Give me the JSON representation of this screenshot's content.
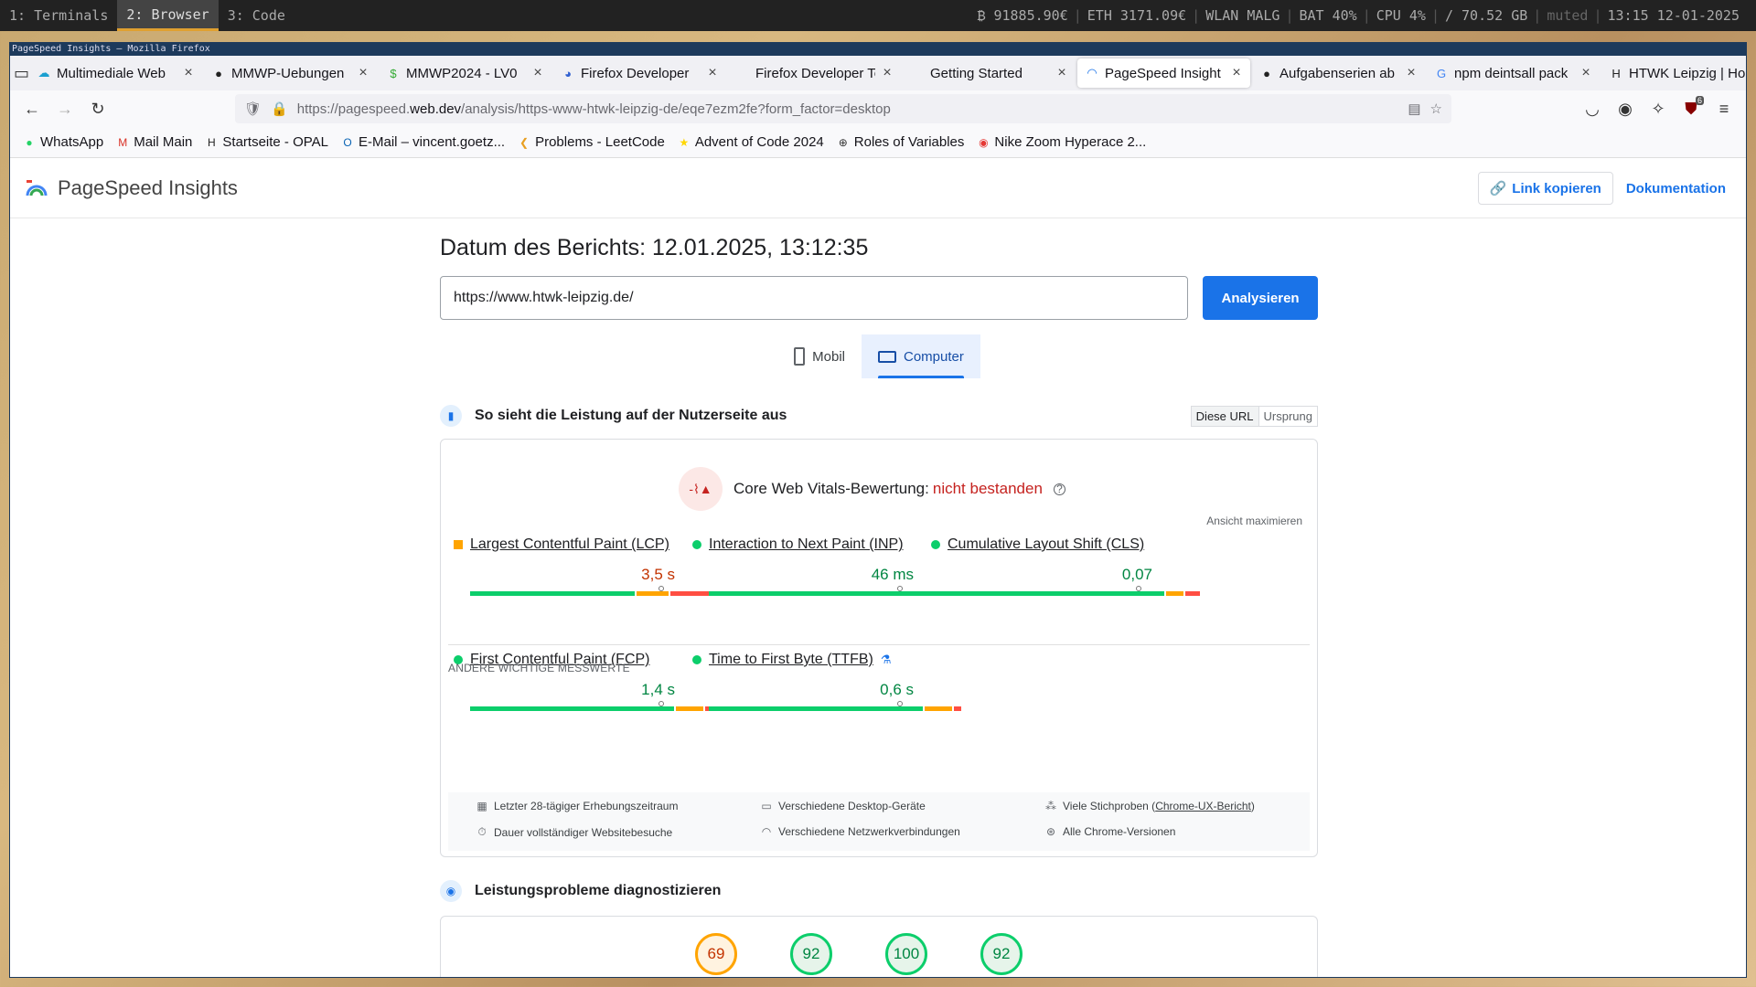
{
  "statusbar": {
    "workspaces": [
      "1: Terminals",
      "2: Browser",
      "3: Code"
    ],
    "btc": "₿ 91885.90€",
    "eth": "ETH 3171.09€",
    "wlan": "WLAN MALG",
    "bat": "BAT 40%",
    "cpu": "CPU  4%",
    "disk": "/ 70.52 GB",
    "audio": "muted",
    "clock": "13:15 12-01-2025"
  },
  "window_title": "PageSpeed Insights — Mozilla Firefox",
  "tabs": [
    {
      "label": "Multimediale Web",
      "icon": "cloud-icon",
      "color": "#1a9fd0"
    },
    {
      "label": "MMWP-Uebungen",
      "icon": "github-icon",
      "color": "#222"
    },
    {
      "label": "MMWP2024 - LV0",
      "icon": "dollar-icon",
      "color": "#3a3"
    },
    {
      "label": "Firefox Developer",
      "icon": "firefox-icon",
      "color": "#3060d0"
    },
    {
      "label": "Firefox Developer Too",
      "icon": "none",
      "color": "#222"
    },
    {
      "label": "Getting Started",
      "icon": "none",
      "color": "#222"
    },
    {
      "label": "PageSpeed Insight",
      "icon": "pagespeed-icon",
      "color": "#1a73e8"
    },
    {
      "label": "Aufgabenserien ab",
      "icon": "github-icon",
      "color": "#222"
    },
    {
      "label": "npm deintsall pack",
      "icon": "google-icon",
      "color": "#4285f4"
    },
    {
      "label": "HTWK Leipzig | Ho",
      "icon": "htwk-icon",
      "color": "#222"
    }
  ],
  "urlbar": {
    "prefix": "https://pagespeed.",
    "domain": "web.dev",
    "path": "/analysis/https-www-htwk-leipzig-de/eqe7ezm2fe?form_factor=desktop"
  },
  "ext_badge": "6",
  "bookmarks": [
    {
      "label": "WhatsApp",
      "icon": "whatsapp-icon",
      "glyph": "●",
      "color": "#25d366"
    },
    {
      "label": "Mail Main",
      "icon": "gmail-icon",
      "glyph": "M",
      "color": "#d93025"
    },
    {
      "label": "Startseite - OPAL",
      "icon": "opal-icon",
      "glyph": "H",
      "color": "#222"
    },
    {
      "label": "E-Mail – vincent.goetz...",
      "icon": "outlook-icon",
      "glyph": "O",
      "color": "#0a64b4"
    },
    {
      "label": "Problems - LeetCode",
      "icon": "leetcode-icon",
      "glyph": "❮",
      "color": "#e89f21"
    },
    {
      "label": "Advent of Code 2024",
      "icon": "aoc-icon",
      "glyph": "★",
      "color": "#ffd700"
    },
    {
      "label": "Roles of Variables",
      "icon": "globe-icon",
      "glyph": "⊕",
      "color": "#333"
    },
    {
      "label": "Nike Zoom Hyperace 2...",
      "icon": "nike-icon",
      "glyph": "◉",
      "color": "#e53935"
    }
  ],
  "psi": {
    "brand": "PageSpeed Insights",
    "copy_link": "Link kopieren",
    "docs": "Dokumentation",
    "report_date": "Datum des Berichts: 12.01.2025, 13:12:35",
    "url_value": "https://www.htwk-leipzig.de/",
    "analyze": "Analysieren",
    "device_mobile": "Mobil",
    "device_desktop": "Computer",
    "field_title": "So sieht die Leistung auf der Nutzerseite aus",
    "toggle_url": "Diese URL",
    "toggle_origin": "Ursprung",
    "cwv_label": "Core Web Vitals-Bewertung:",
    "cwv_status": "nicht bestanden",
    "maximize": "Ansicht maximieren",
    "other_metrics": "ANDERE WICHTIGE MESSWERTE",
    "diag_title": "Leistungsprobleme diagnostizieren",
    "metrics": [
      {
        "label": "Largest Contentful Paint (LCP)",
        "value": "3,5 s",
        "status": "needs-improvement",
        "color": "#c33300",
        "distribution": [
          0.66,
          0.13,
          0.21
        ],
        "marker": 0.75
      },
      {
        "label": "Interaction to Next Paint (INP)",
        "value": "46 ms",
        "status": "good",
        "color": "#018642",
        "distribution": [
          0.97,
          0.015,
          0.015
        ],
        "marker": 0.75
      },
      {
        "label": "Cumulative Layout Shift (CLS)",
        "value": "0,07",
        "status": "good",
        "color": "#018642",
        "distribution": [
          0.87,
          0.07,
          0.06
        ],
        "marker": 0.75
      },
      {
        "label": "First Contentful Paint (FCP)",
        "value": "1,4 s",
        "status": "good",
        "color": "#018642",
        "distribution": [
          0.82,
          0.11,
          0.07
        ],
        "marker": 0.75
      },
      {
        "label": "Time to First Byte (TTFB)",
        "value": "0,6 s",
        "status": "good",
        "color": "#018642",
        "distribution": [
          0.86,
          0.11,
          0.03
        ],
        "marker": 0.75
      }
    ],
    "info": {
      "period": "Letzter 28-tägiger Erhebungszeitraum",
      "duration": "Dauer vollständiger Websitebesuche",
      "devices": "Verschiedene Desktop-Geräte",
      "network": "Verschiedene Netzwerkverbindungen",
      "samples_prefix": "Viele Stichproben (",
      "samples_link": "Chrome-UX-Bericht",
      "samples_suffix": ")",
      "chrome": "Alle Chrome-Versionen"
    },
    "scores": [
      {
        "value": "69",
        "color": "#c33300",
        "bg": "#fff3e0",
        "ring": "#ffa400"
      },
      {
        "value": "92",
        "color": "#018642",
        "bg": "#e6f4ea",
        "ring": "#0cce6b"
      },
      {
        "value": "100",
        "color": "#018642",
        "bg": "#e6f4ea",
        "ring": "#0cce6b"
      },
      {
        "value": "92",
        "color": "#018642",
        "bg": "#e6f4ea",
        "ring": "#0cce6b"
      }
    ]
  }
}
